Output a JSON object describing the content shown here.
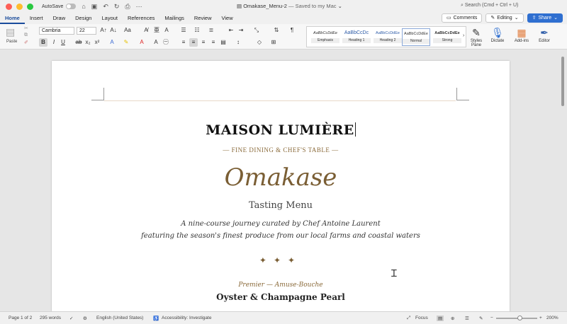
{
  "titlebar": {
    "autosave_label": "AutoSave",
    "doc_name": "Omakase_Menu-2",
    "saved_status": "— Saved to my Mac",
    "search_placeholder": "Search (Cmd + Ctrl + U)"
  },
  "tabs": [
    "Home",
    "Insert",
    "Draw",
    "Design",
    "Layout",
    "References",
    "Mailings",
    "Review",
    "View"
  ],
  "right_buttons": {
    "comments": "Comments",
    "editing": "Editing",
    "share": "Share"
  },
  "ribbon": {
    "paste_label": "Paste",
    "font_name": "Cambria",
    "font_size": "22",
    "styles": [
      {
        "preview": "AaBbCcDdEe",
        "name": "Emphasis"
      },
      {
        "preview": "AaBbCcDc",
        "name": "Heading 1"
      },
      {
        "preview": "AaBbCcDdEe",
        "name": "Heading 2"
      },
      {
        "preview": "AaBbCcDdEe",
        "name": "Normal"
      },
      {
        "preview": "AaBbCcDdEe",
        "name": "Strong"
      }
    ],
    "styles_pane": "Styles Pane",
    "dictate": "Dictate",
    "addins": "Add-ins",
    "editor": "Editor"
  },
  "document": {
    "brand": "MAISON LUMIÈRE",
    "tagline": "— FINE DINING & CHEF'S TABLE —",
    "title": "Omakase",
    "subtitle": "Tasting Menu",
    "desc_line1": "A nine-course journey curated by Chef Antoine Laurent",
    "desc_line2": "featuring the season's finest produce from our local farms and coastal waters",
    "ornament": "✦✦✦",
    "course_label": "Premier — Amuse-Bouche",
    "dish_name": "Oyster & Champagne Pearl"
  },
  "statusbar": {
    "page": "Page 1 of 2",
    "words": "295 words",
    "language": "English (United States)",
    "accessibility": "Accessibility: Investigate",
    "focus": "Focus",
    "zoom": "200%"
  }
}
